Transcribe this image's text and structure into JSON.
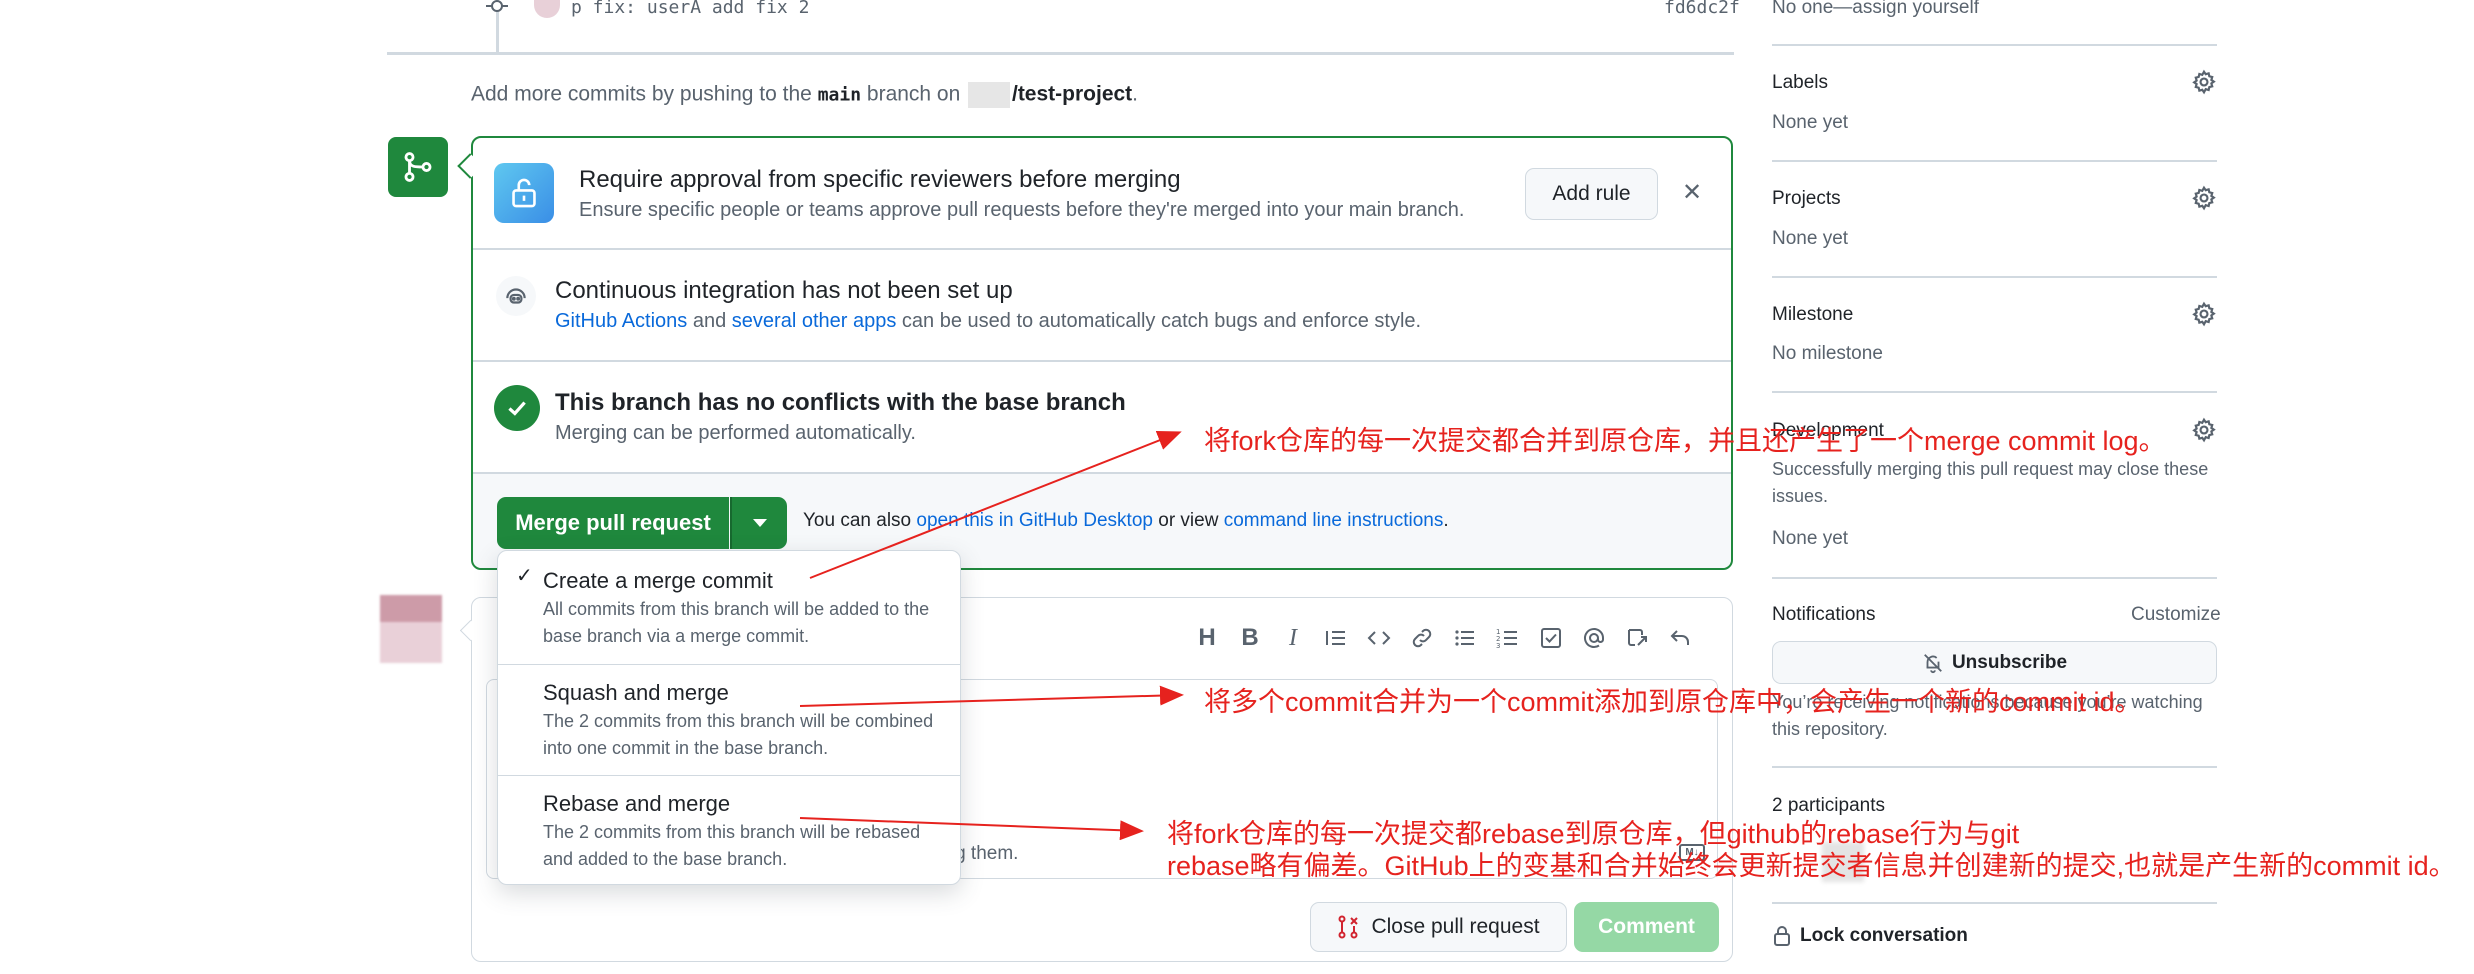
{
  "timeline": {
    "last_commit_text": "p fix: userA add fix 2",
    "last_commit_sha": "fd6dc2f",
    "push_hint_prefix": "Add more commits by pushing to the",
    "push_hint_branch": "main",
    "push_hint_middle": "branch on",
    "push_hint_repo": "/test-project",
    "push_hint_suffix": "."
  },
  "merge_box": {
    "rule": {
      "title": "Require approval from specific reviewers before merging",
      "description": "Ensure specific people or teams approve pull requests before they're merged into your main branch.",
      "add_rule_label": "Add rule",
      "close_glyph": "✕"
    },
    "ci": {
      "title": "Continuous integration has not been set up",
      "link1": "GitHub Actions",
      "and_text": "and",
      "link2": "several other apps",
      "rest": "can be used to automatically catch bugs and enforce style."
    },
    "conflicts": {
      "title": "This branch has no conflicts with the base branch",
      "description": "Merging can be performed automatically."
    },
    "merge_button_label": "Merge pull request",
    "also_prefix": "You can also",
    "open_desktop_link": "open this in GitHub Desktop",
    "or_view": "or view",
    "cli_link": "command line instructions",
    "also_suffix": "."
  },
  "dropdown": {
    "options": [
      {
        "title": "Create a merge commit",
        "desc_line1": "All commits from this branch will be added to the",
        "desc_line2": "base branch via a merge commit.",
        "checked": true
      },
      {
        "title": "Squash and merge",
        "desc_line1": "The 2 commits from this branch will be combined",
        "desc_line2": "into one commit in the base branch.",
        "checked": false
      },
      {
        "title": "Rebase and merge",
        "desc_line1": "The 2 commits from this branch will be rebased",
        "desc_line2": "and added to the base branch.",
        "checked": false
      }
    ]
  },
  "comment_box": {
    "hint_fragment": "ting them.",
    "close_pr_label": "Close pull request",
    "comment_label": "Comment"
  },
  "sidebar": {
    "assignees_value": "No one—assign yourself",
    "labels": {
      "title": "Labels",
      "value": "None yet"
    },
    "projects": {
      "title": "Projects",
      "value": "None yet"
    },
    "milestone": {
      "title": "Milestone",
      "value": "No milestone"
    },
    "development": {
      "title": "Development",
      "desc_line1": "Successfully merging this pull request may close these",
      "desc_line2": "issues.",
      "value": "None yet"
    },
    "notifications": {
      "title": "Notifications",
      "customize": "Customize",
      "unsubscribe_label": "Unsubscribe",
      "desc_line1": "You’re receiving notifications because you’re watching",
      "desc_line2": "this repository."
    },
    "participants_title": "2 participants",
    "lock_label": "Lock conversation"
  },
  "annotations": {
    "merge_commit": "将fork仓库的每一次提交都合并到原仓库，并且还产生了一个merge commit log。",
    "squash": "将多个commit合并为一个commit添加到原仓库中，会产生一个新的commit id。",
    "rebase_line1": "将fork仓库的每一次提交都rebase到原仓库，但github的rebase行为与git",
    "rebase_line2": "rebase略有偏差。GitHub上的变基和合并始终会更新提交者信息并创建新的提交,也就是产生新的commit id。"
  },
  "colors": {
    "primary_green": "#1f883d",
    "link_blue": "#0969da",
    "annotation_red": "#e6221e",
    "border": "#d1d9e0"
  }
}
